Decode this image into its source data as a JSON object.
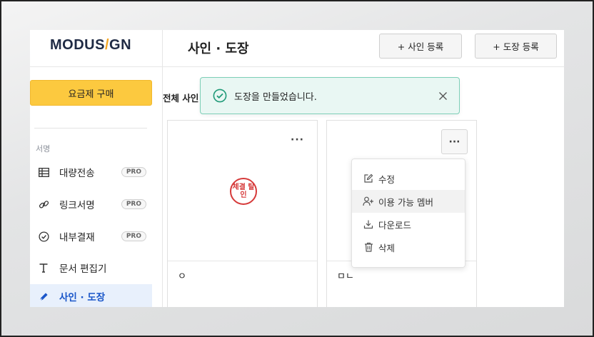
{
  "brand": {
    "logo_left": "MODUS",
    "logo_slash": "/",
    "logo_right": "GN"
  },
  "sidebar": {
    "buy_label": "요금제 구매",
    "section_label": "서명",
    "items": [
      {
        "label": "대량전송",
        "badge": "PRO",
        "icon": "table-icon"
      },
      {
        "label": "링크서명",
        "badge": "PRO",
        "icon": "link-icon"
      },
      {
        "label": "내부결재",
        "badge": "PRO",
        "icon": "check-circle-icon"
      },
      {
        "label": "문서 편집기",
        "badge": "",
        "icon": "text-icon"
      },
      {
        "label": "사인 · 도장",
        "badge": "",
        "icon": "pen-icon",
        "active": true
      }
    ]
  },
  "header": {
    "title": "사인 · 도장",
    "add_sign_label": "+ 사인 등록",
    "add_stamp_label": "+ 도장 등록"
  },
  "main": {
    "all_label": "전체 사인",
    "cards": [
      {
        "name": "ㅇ",
        "stamp_text": "체결 탈인",
        "more": "···"
      },
      {
        "name": "ㅁㄴ",
        "more": "···"
      }
    ]
  },
  "menu": {
    "items": [
      {
        "label": "수정",
        "icon": "edit-icon"
      },
      {
        "label": "이용 가능 멤버",
        "icon": "user-plus-icon"
      },
      {
        "label": "다운로드",
        "icon": "download-icon"
      },
      {
        "label": "삭제",
        "icon": "trash-icon"
      }
    ]
  },
  "toast": {
    "message": "도장을 만들었습니다."
  },
  "colors": {
    "accent": "#fcc93f",
    "active": "#1a56c9",
    "toast_bg": "#e9f7f3",
    "toast_border": "#7dcfb7",
    "stamp": "#d63a3a"
  }
}
